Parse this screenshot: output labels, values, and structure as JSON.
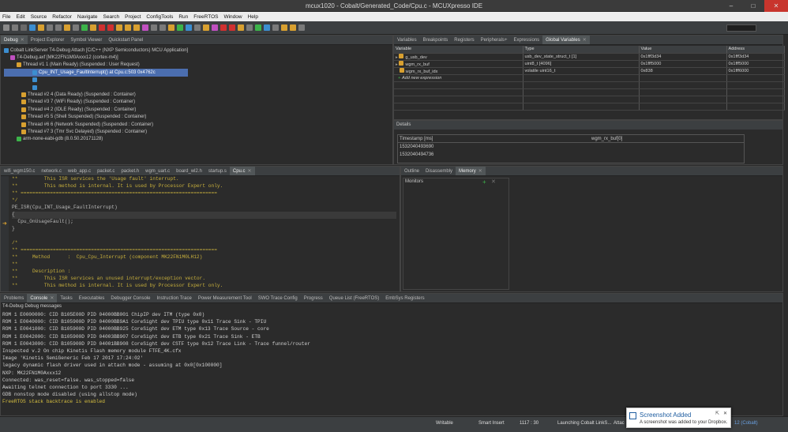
{
  "window": {
    "title": "mcux1020 - Cobalt/Generated_Code/Cpu.c - MCUXpresso IDE"
  },
  "menu": [
    "File",
    "Edit",
    "Source",
    "Refactor",
    "Navigate",
    "Search",
    "Project",
    "ConfigTools",
    "Run",
    "FreeRTOS",
    "Window",
    "Help"
  ],
  "debug": {
    "tabs": [
      "Debug",
      "Project Explorer",
      "Symbol Viewer",
      "Quickstart Panel"
    ],
    "tree": [
      "Cobalt LinkServer T4-Debug Attach [C/C++ (NXP Semiconductors) MCU Application]",
      "T4-Debug.axf [MK22FN1M0Axxx12 (cortex-m4)]",
      "Thread #1 1 (Main Ready) (Suspended : User Request)",
      "Cpu_INT_Usage_FaultInterrupt() at Cpu.c:503 0x4762c",
      "",
      "",
      "Thread #2 4 (Data Ready) (Suspended : Container)",
      "Thread #3 7 (WiFi Ready) (Suspended : Container)",
      "Thread #4 2 (IDLE Ready) (Suspended : Container)",
      "Thread #5 5 (Shell Suspended) (Suspended : Container)",
      "Thread #6 6 (Network Suspended) (Suspended : Container)",
      "Thread #7 3 (Tmr Svc Delayed) (Suspended : Container)",
      "arm-none-eabi-gdb (8.0.50.20171128)"
    ]
  },
  "globals": {
    "tabs": [
      "Variables",
      "Breakpoints",
      "Registers",
      "Peripherals+",
      "Expressions",
      "Global Variables"
    ],
    "headers": [
      "Variable",
      "Type",
      "Value",
      "Address"
    ],
    "rows": [
      [
        "g_usb_dev",
        "usb_dev_state_struct_t [1]",
        "0x1fff3d34",
        "0x1fff3d34"
      ],
      [
        "wgm_rx_buf",
        "uint8_t [4096]",
        "0x1fff5000",
        "0x1fff5000"
      ],
      [
        "wgm_rx_buf_idx",
        "volatile uint16_t",
        "0x838",
        "0x1fff6000"
      ],
      [
        "Add new expression",
        "",
        "",
        ""
      ]
    ],
    "details_label": "Details",
    "details_headers": [
      "Timestamp [ms]",
      "wgm_rx_buf[0]"
    ],
    "details_rows": [
      "1532040493690",
      "1532040494736"
    ]
  },
  "editor": {
    "tabs": [
      "wifi_wgm150.c",
      "network.c",
      "web_app.c",
      "packet.c",
      "packet.h",
      "wgm_uart.c",
      "board_wl2.h",
      "startup.s",
      "Cpu.c"
    ],
    "lines": [
      "**         This ISR services the 'Usage fault' interrupt.",
      "**         This method is internal. It is used by Processor Expert only.",
      "** ===================================================================",
      "*/",
      "PE_ISR(Cpu_INT_Usage_FaultInterrupt)",
      "{",
      "  Cpu_OnUsageFault();",
      "}",
      "",
      "/*",
      "** ===================================================================",
      "**     Method      :  Cpu_Cpu_Interrupt (component MK22FN1M0LH12)",
      "**",
      "**     Description :",
      "**         This ISR services an unused interrupt/exception vector.",
      "**         This method is internal. It is used by Processor Expert only."
    ]
  },
  "memory": {
    "tabs": [
      "Outline",
      "Disassembly",
      "Memory"
    ],
    "monitors_label": "Monitors"
  },
  "console": {
    "tabs": [
      "Problems",
      "Console",
      "Tasks",
      "Executables",
      "Debugger Console",
      "Instruction Trace",
      "Power Measurement Tool",
      "SWO Trace Config",
      "Progress",
      "Queue List (FreeRTOS)",
      "EmbSys Registers"
    ],
    "header": "T4-Debug Debug messages",
    "lines": [
      "ROM 1 E0000000: CID B105E00D PID 04000BB001 ChipIP dev ITM (type 0x0)",
      "ROM 1 E0040000: CID B105900D PID 04000BB9A1 CoreSight dev TPIU type 0x11 Trace Sink - TPIU",
      "ROM 1 E0041000: CID B105900D PID 04000BB925 CoreSight dev ETM type 0x13 Trace Source - core",
      "ROM 1 E0042000: CID B105900D PID 04003BB907 CoreSight dev ETB type 0x21 Trace Sink - ETB",
      "ROM 1 E0043000: CID B105900D PID 04001BB908 CoreSight dev CSTF type 0x12 Trace Link - Trace funnel/router",
      "Inspected v.2 On chip Kinetis Flash memory module FTFE_4K.cfx",
      "Image 'Kinetis SemiGeneric Feb 17 2017 17:24:02'",
      "legacy dynamic flash driver used in attach mode - assuming at 0x0[0x100000]",
      "NXP: MK22FN1M0Axxx12",
      "Connected: was_reset=false. was_stopped=false",
      "Awaiting telnet connection to port 3330 ...",
      "GDB nonstop mode disabled (using allstop mode)",
      "FreeRTOS stack backtrace is enabled"
    ]
  },
  "status": {
    "writable": "Writable",
    "insert": "Smart Insert",
    "position": "1117 : 30",
    "launching": "Launching Cobalt LinkS...",
    "attach": "Attac",
    "cobalt": "12 (Cobalt)"
  },
  "toast": {
    "title": "Screenshot Added",
    "body": "A screenshot was added to your Dropbox."
  }
}
